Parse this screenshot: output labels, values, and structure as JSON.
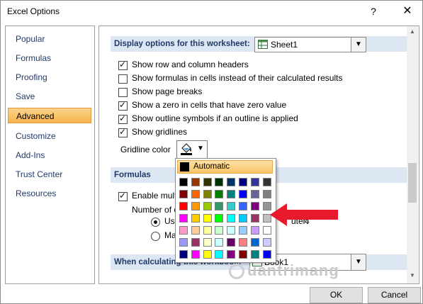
{
  "window": {
    "title": "Excel Options",
    "help_label": "?",
    "close_label": "✕"
  },
  "nav": {
    "items": [
      {
        "label": "Popular"
      },
      {
        "label": "Formulas"
      },
      {
        "label": "Proofing"
      },
      {
        "label": "Save"
      },
      {
        "label": "Advanced",
        "selected": true
      },
      {
        "label": "Customize"
      },
      {
        "label": "Add-Ins"
      },
      {
        "label": "Trust Center"
      },
      {
        "label": "Resources"
      }
    ]
  },
  "display": {
    "header": "Display options for this worksheet:",
    "sheet_value": "Sheet1",
    "options": [
      {
        "label": "Show row and column headers",
        "checked": true
      },
      {
        "label": "Show formulas in cells instead of their calculated results",
        "checked": false
      },
      {
        "label": "Show page breaks",
        "checked": false
      },
      {
        "label": "Show a zero in cells that have zero value",
        "checked": true
      },
      {
        "label": "Show outline symbols if an outline is applied",
        "checked": true
      },
      {
        "label": "Show gridlines",
        "checked": true
      }
    ],
    "gridline_color_label": "Gridline color"
  },
  "formulas": {
    "header": "Formulas",
    "enable_multi_label": "Enable mult",
    "number_label": "Number of c",
    "use_label": "Use",
    "use_suffix": "uter:",
    "use_value": "4",
    "manual_label": "Ma"
  },
  "calc": {
    "header": "When calculating this workbook:",
    "workbook_value": "Book1"
  },
  "palette": {
    "automatic_label": "Automatic",
    "rows": [
      [
        "#000000",
        "#993300",
        "#333300",
        "#003300",
        "#003366",
        "#000080",
        "#333399",
        "#333333"
      ],
      [
        "#800000",
        "#FF6600",
        "#808000",
        "#008000",
        "#008080",
        "#0000FF",
        "#666699",
        "#808080"
      ],
      [
        "#FF0000",
        "#FF9900",
        "#99CC00",
        "#339966",
        "#33CCCC",
        "#3366FF",
        "#800080",
        "#969696"
      ],
      [
        "#FF00FF",
        "#FFCC00",
        "#FFFF00",
        "#00FF00",
        "#00FFFF",
        "#00CCFF",
        "#993366",
        "#C0C0C0"
      ],
      [
        "#FF99CC",
        "#FFCC99",
        "#FFFF99",
        "#CCFFCC",
        "#CCFFFF",
        "#99CCFF",
        "#CC99FF",
        "#FFFFFF"
      ],
      [
        "#9999FF",
        "#993366",
        "#FFFFCC",
        "#CCFFFF",
        "#660066",
        "#FF8080",
        "#0066CC",
        "#CCCCFF"
      ],
      [
        "#000080",
        "#FF00FF",
        "#FFFF00",
        "#00FFFF",
        "#800080",
        "#800000",
        "#008080",
        "#0000FF"
      ]
    ]
  },
  "buttons": {
    "ok": "OK",
    "cancel": "Cancel"
  },
  "watermark": "uantrimang",
  "colors": {
    "accent_arrow": "#e8192c",
    "section_header_bg": "#dde6f3",
    "selected_nav": "#f7b54e"
  },
  "icons": {
    "help": "help-icon",
    "close": "close-icon",
    "fill_bucket": "fill-color-icon",
    "sheet": "sheet-icon",
    "dropdown": "chevron-down-icon"
  }
}
